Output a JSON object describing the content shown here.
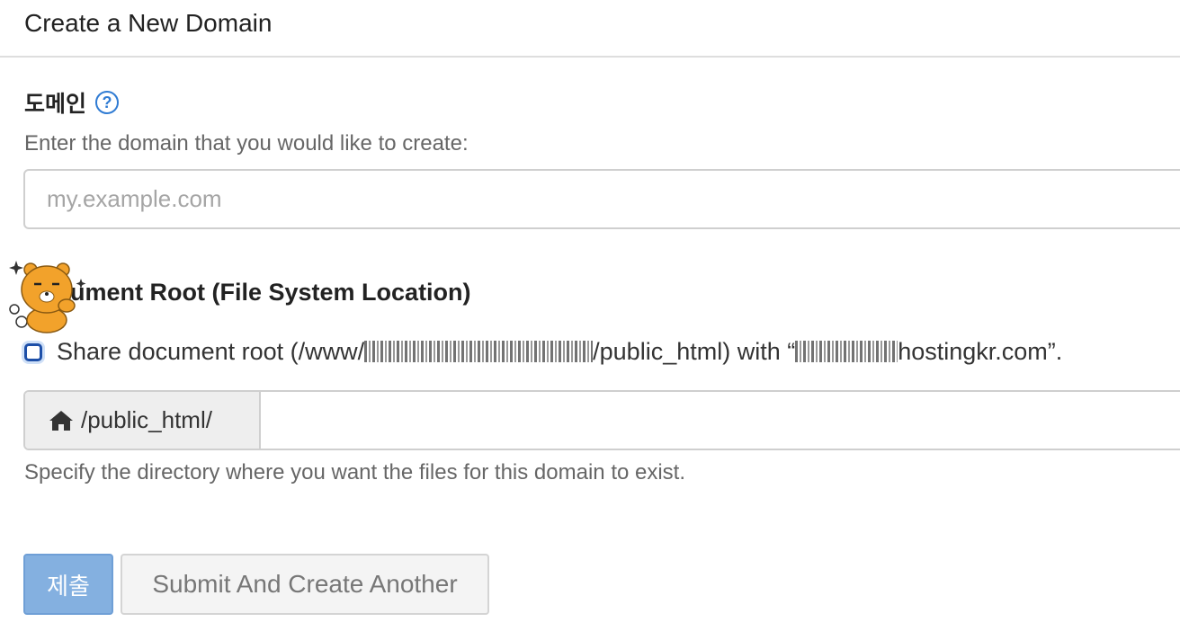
{
  "header": {
    "title": "Create a New Domain"
  },
  "domain": {
    "label": "도메인",
    "help_glyph": "?",
    "hint": "Enter the domain that you would like to create:",
    "placeholder": "my.example.com",
    "value": ""
  },
  "docroot": {
    "title": "Document Root (File System Location)",
    "share_prefix": "Share document root (/www/",
    "share_middle": "/public_html) with “",
    "share_suffix": "hostingkr.com”.",
    "checked": false,
    "addon_path": "/public_html/",
    "value": "",
    "hint": "Specify the directory where you want the files for this domain to exist."
  },
  "buttons": {
    "submit": "제출",
    "submit_another": "Submit And Create Another"
  },
  "colors": {
    "accent": "#2f7bd3",
    "submit_bg": "#84b0e0"
  },
  "icons": {
    "help": "question-circle-icon",
    "home": "home-icon",
    "sticker": "bear-sticker"
  }
}
